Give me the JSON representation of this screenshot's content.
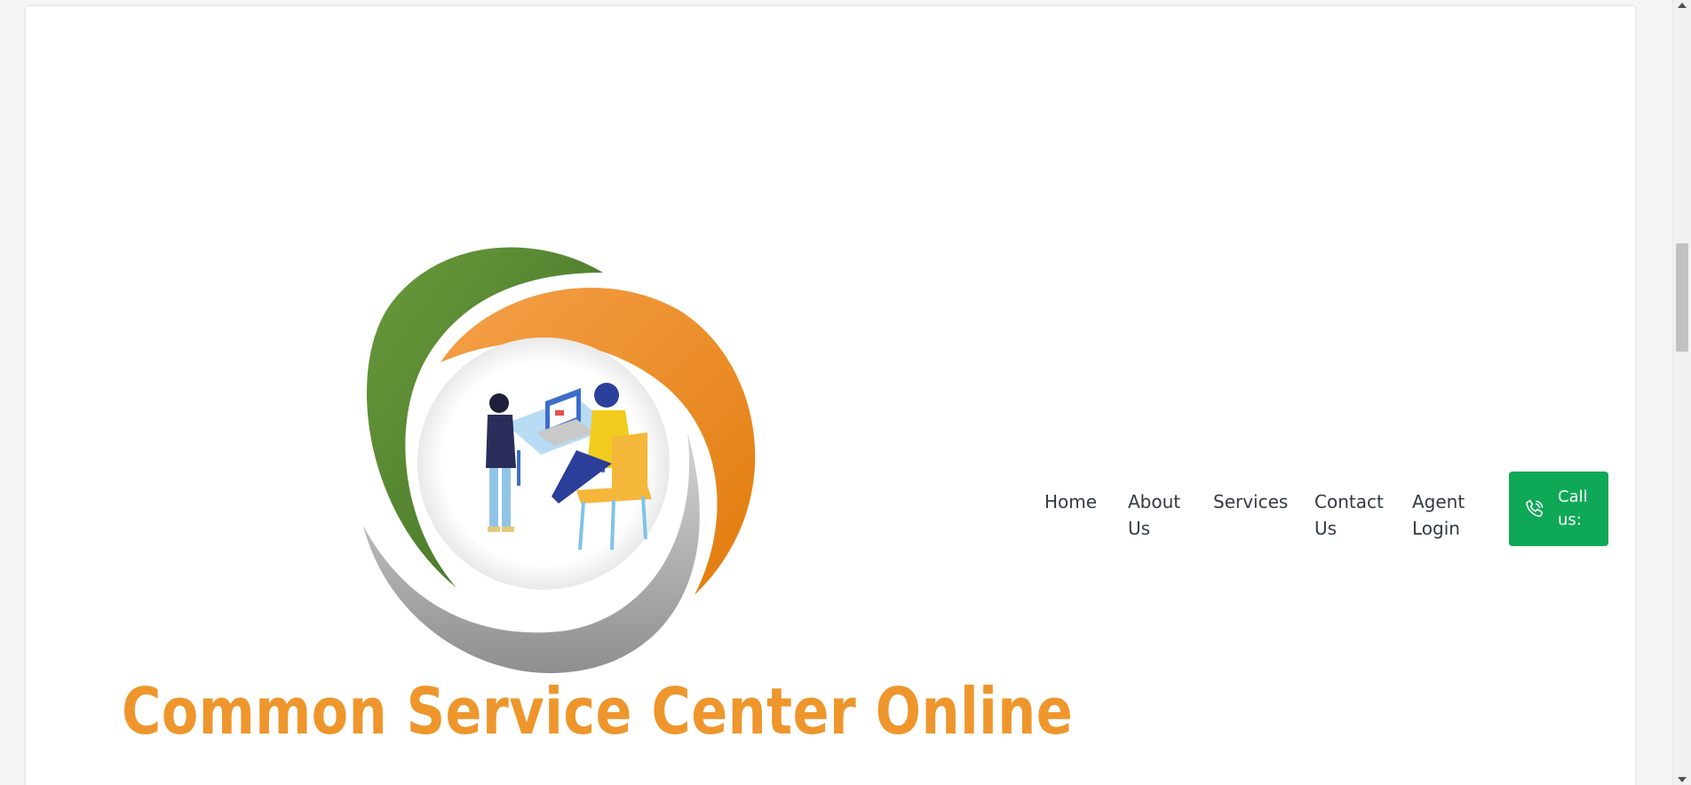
{
  "logo": {
    "text": "Common Service Center Online",
    "text_color": "#ee962c",
    "ring_colors": [
      "#4e7f31",
      "#ee8b1c",
      "#b0b0b0"
    ]
  },
  "nav": {
    "items": [
      {
        "label_line1": "Home",
        "label_line2": ""
      },
      {
        "label_line1": "About",
        "label_line2": "Us"
      },
      {
        "label_line1": "Services",
        "label_line2": ""
      },
      {
        "label_line1": "Contact",
        "label_line2": "Us"
      },
      {
        "label_line1": "Agent",
        "label_line2": "Login"
      }
    ]
  },
  "call_button": {
    "label_line1": "Call",
    "label_line2": "us:",
    "icon": "phone-icon",
    "color": "#0fa857"
  }
}
